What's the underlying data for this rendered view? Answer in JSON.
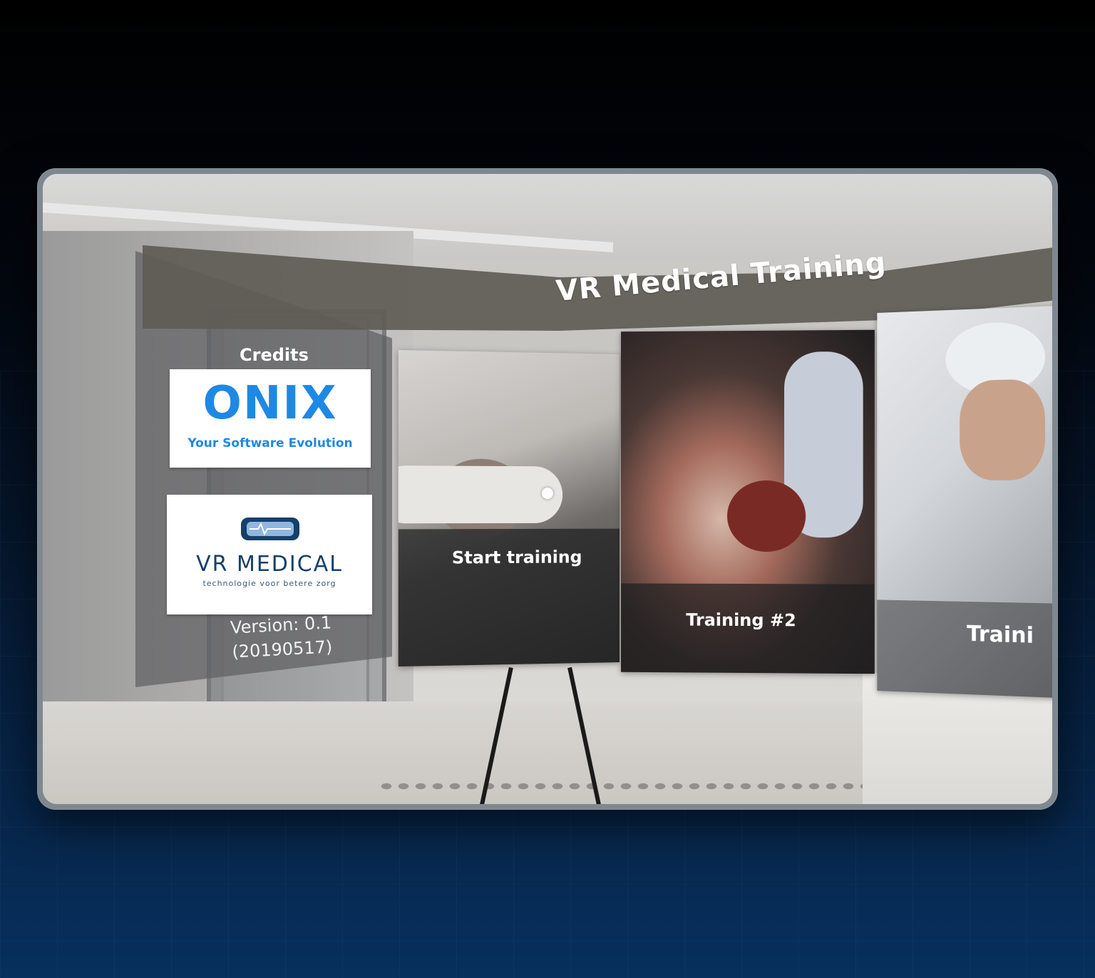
{
  "app": {
    "title": "VR Medical Training"
  },
  "credits": {
    "label": "Credits",
    "logos": [
      {
        "name": "ONIX",
        "tagline": "Your Software Evolution"
      },
      {
        "name": "VR MEDICAL",
        "tagline": "technologie voor betere zorg"
      }
    ],
    "version_line1": "Version: 0.1",
    "version_line2": "(20190517)"
  },
  "trainings": [
    {
      "label": "Start training"
    },
    {
      "label": "Training #2"
    },
    {
      "label": "Traini"
    }
  ],
  "colors": {
    "onix_blue": "#1e88e5",
    "vr_medical_navy": "#15406a",
    "panel_band": "#605c56"
  }
}
